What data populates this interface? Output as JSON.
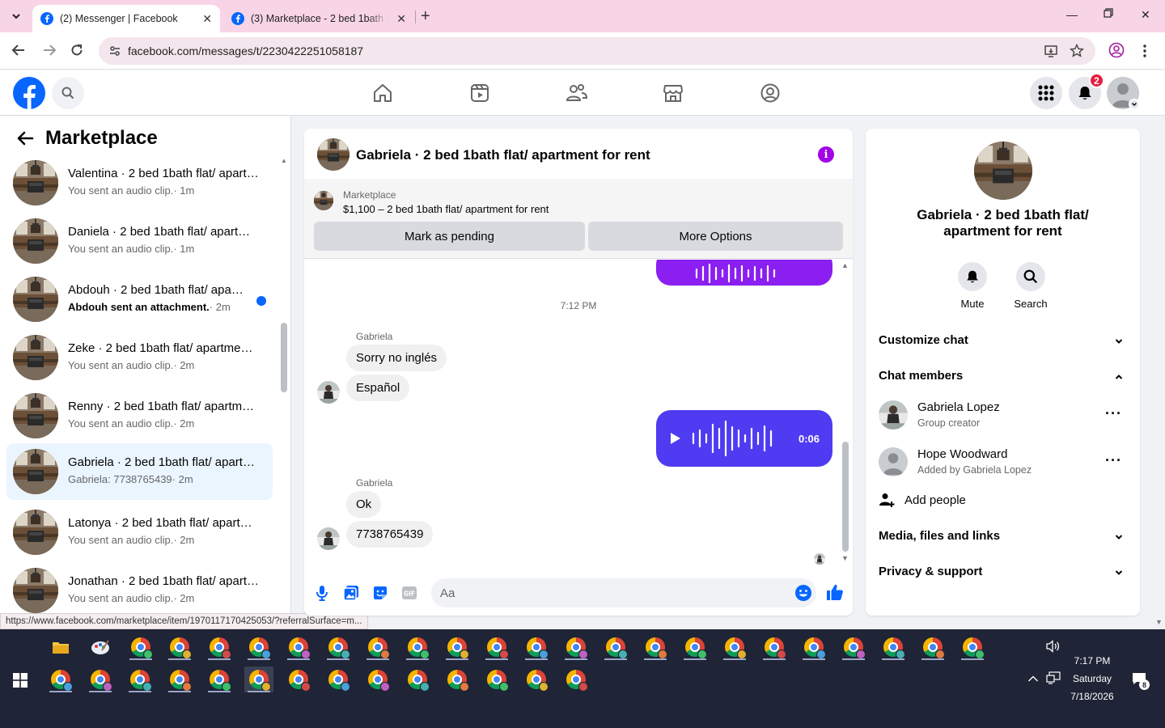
{
  "browser": {
    "tabs": [
      {
        "title": "(2) Messenger | Facebook",
        "active": true
      },
      {
        "title": "(3) Marketplace - 2 bed 1bath f",
        "active": false
      }
    ],
    "url": "facebook.com/messages/t/2230422251058187",
    "status_url": "https://www.facebook.com/marketplace/item/1970117170425053/?referralSurface=m..."
  },
  "fb": {
    "notification_count": "2"
  },
  "sidebar": {
    "title": "Marketplace",
    "conversations": [
      {
        "name": "Valentina · 2 bed 1bath flat/ apartment for rent",
        "preview": "You sent an audio clip.",
        "time": "· 1m",
        "unread": false,
        "active": false
      },
      {
        "name": "Daniela · 2 bed 1bath flat/ apartment for rent",
        "preview": "You sent an audio clip.",
        "time": "· 1m",
        "unread": false,
        "active": false
      },
      {
        "name": "Abdouh · 2 bed 1bath flat/ apartment for rent",
        "preview": "Abdouh sent an attachment.",
        "time": "· 2m",
        "unread": true,
        "active": false
      },
      {
        "name": "Zeke · 2 bed 1bath flat/ apartment for rent",
        "preview": "You sent an audio clip.",
        "time": "· 2m",
        "unread": false,
        "active": false
      },
      {
        "name": "Renny · 2 bed 1bath flat/ apartment for rent",
        "preview": "You sent an audio clip.",
        "time": "· 2m",
        "unread": false,
        "active": false
      },
      {
        "name": "Gabriela · 2 bed 1bath flat/ apartment for rent",
        "preview": "Gabriela: 7738765439",
        "time": "· 2m",
        "unread": false,
        "active": true
      },
      {
        "name": "Latonya · 2 bed 1bath flat/ apartment for rent",
        "preview": "You sent an audio clip.",
        "time": "· 2m",
        "unread": false,
        "active": false
      },
      {
        "name": "Jonathan · 2 bed 1bath flat/ apartment for rent",
        "preview": "You sent an audio clip.",
        "time": "· 2m",
        "unread": false,
        "active": false
      }
    ]
  },
  "chat": {
    "title": "Gabriela · 2 bed 1bath flat/ apartment for rent",
    "marketplace_label": "Marketplace",
    "listing": "$1,100 – 2 bed 1bath flat/ apartment for rent",
    "mark_pending": "Mark as pending",
    "more_options": "More Options",
    "timestamp": "7:12 PM",
    "group1": {
      "sender": "Gabriela",
      "messages": [
        "Sorry no inglés",
        "Español"
      ]
    },
    "audio_duration": "0:06",
    "group2": {
      "sender": "Gabriela",
      "messages": [
        "Ok",
        "7738765439"
      ]
    },
    "input_placeholder": "Aa"
  },
  "info": {
    "name": "Gabriela · 2 bed 1bath flat/ apartment for rent",
    "actions": {
      "mute": "Mute",
      "search": "Search"
    },
    "sections": {
      "customize": "Customize chat",
      "members": "Chat members",
      "media": "Media, files and links",
      "privacy": "Privacy & support"
    },
    "members": [
      {
        "name": "Gabriela Lopez",
        "role": "Group creator"
      },
      {
        "name": "Hope Woodward",
        "role": "Added by Gabriela Lopez"
      }
    ],
    "add_people": "Add people"
  },
  "taskbar": {
    "time": "7:17 PM",
    "day": "Saturday",
    "date": "7/18/2026",
    "notifications": "8"
  },
  "colors": {
    "fb_blue": "#0866ff",
    "audio_blue": "#4f3bf2",
    "audio_purple": "#8b1ef0",
    "info_purple": "#a200e8",
    "active_conv_bg": "#ebf5ff"
  }
}
